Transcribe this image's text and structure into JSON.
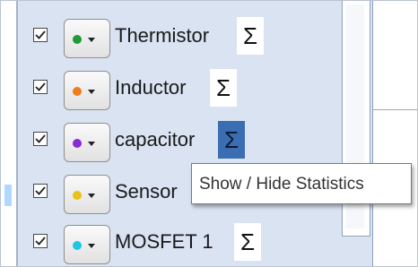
{
  "series": [
    {
      "label": "Thermistor",
      "color": "#1f9a3a",
      "checked": true,
      "stats_active": false
    },
    {
      "label": "Inductor",
      "color": "#f07d1a",
      "checked": true,
      "stats_active": false
    },
    {
      "label": "capacitor",
      "color": "#8a2bd6",
      "checked": true,
      "stats_active": true
    },
    {
      "label": "Sensor",
      "color": "#e8c21a",
      "checked": true,
      "stats_active": false
    },
    {
      "label": "MOSFET 1",
      "color": "#21c4e6",
      "checked": true,
      "stats_active": false
    }
  ],
  "stats_symbol": "Σ",
  "tooltip": "Show / Hide Statistics"
}
